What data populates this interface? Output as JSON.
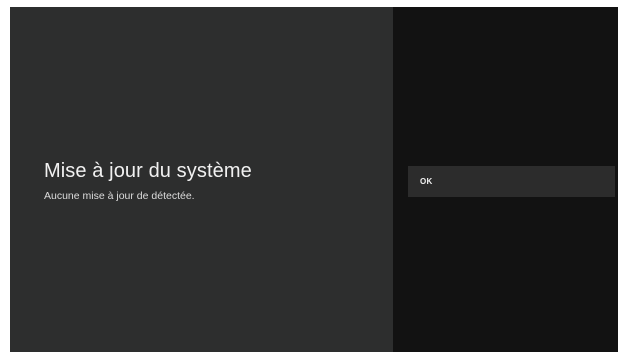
{
  "dialog": {
    "title": "Mise à jour du système",
    "message": "Aucune mise à jour de détectée."
  },
  "actions": [
    {
      "label": "OK"
    }
  ],
  "colors": {
    "left_pane": "#2d2e2e",
    "right_pane": "#121212",
    "action_focus": "#2c2c2c"
  }
}
